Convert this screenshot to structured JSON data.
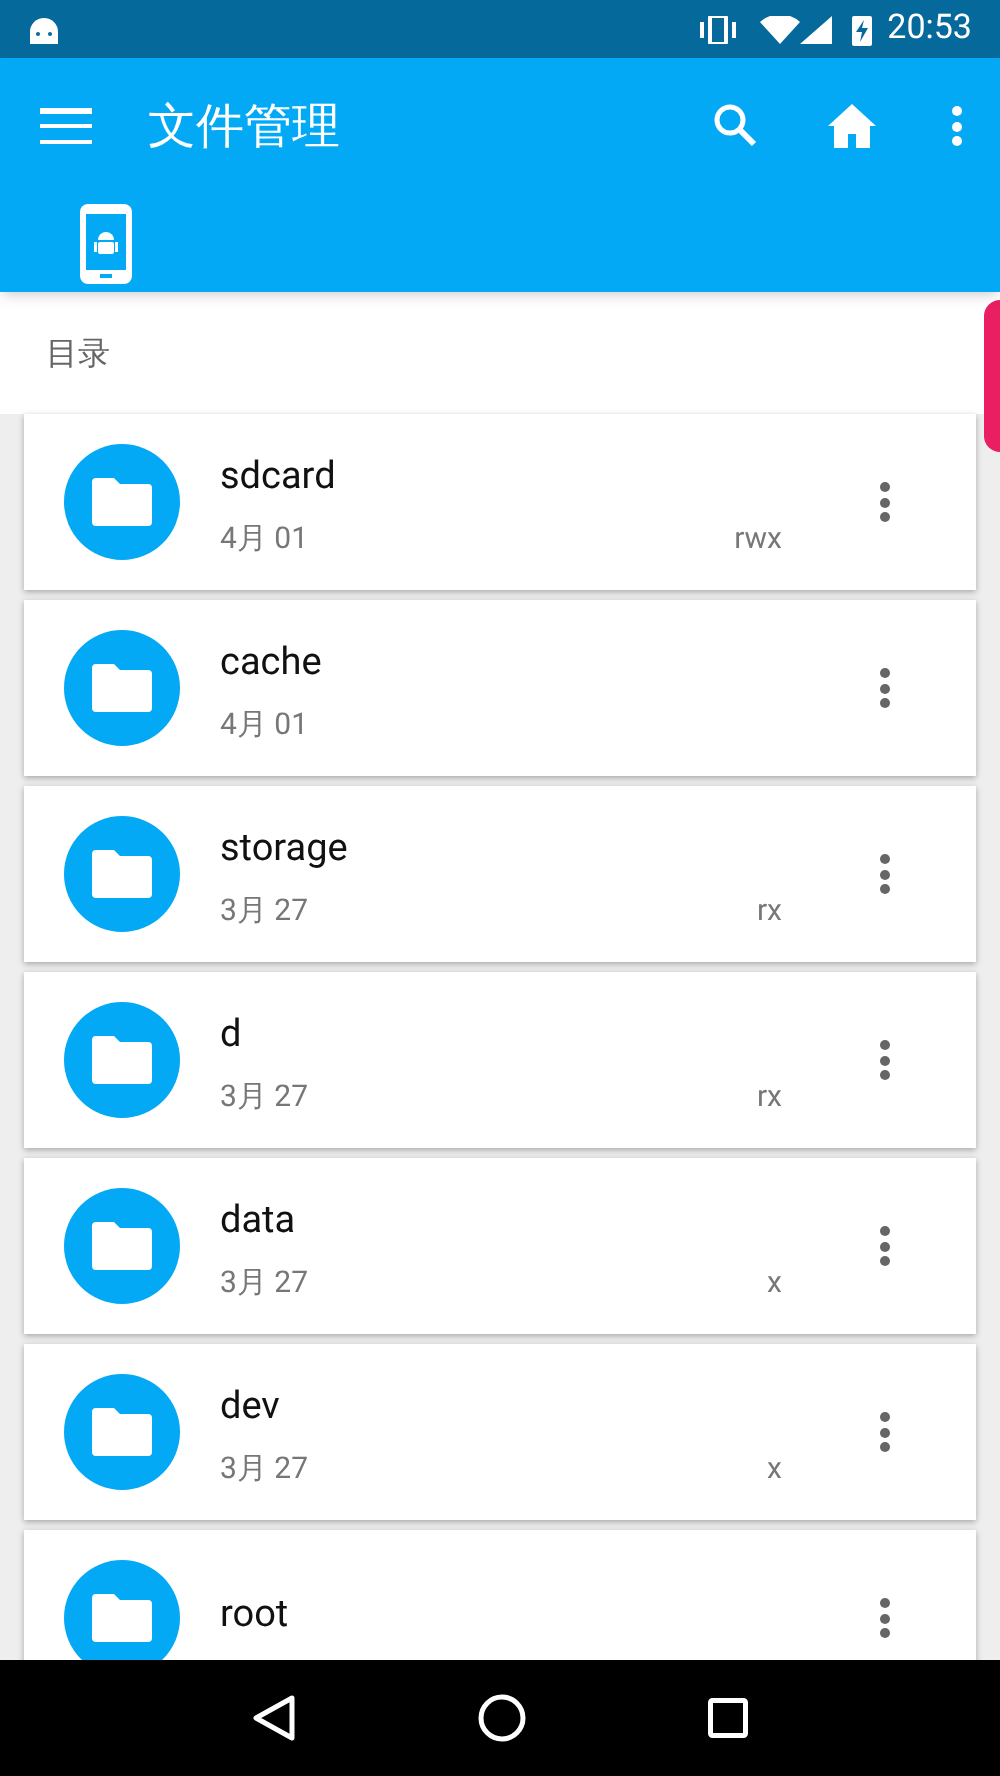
{
  "status_bar": {
    "time": "20:53"
  },
  "toolbar": {
    "title": "文件管理"
  },
  "section": {
    "title": "目录"
  },
  "files": [
    {
      "name": "sdcard",
      "date": "4月 01",
      "permissions": "rwx"
    },
    {
      "name": "cache",
      "date": "4月 01"
    },
    {
      "name": "storage",
      "date": "3月 27",
      "permissions": "rx"
    },
    {
      "name": "d",
      "date": "3月 27",
      "permissions": "rx"
    },
    {
      "name": "data",
      "date": "3月 27",
      "permissions": "x"
    },
    {
      "name": "dev",
      "date": "3月 27",
      "permissions": "x"
    },
    {
      "name": "root"
    }
  ]
}
